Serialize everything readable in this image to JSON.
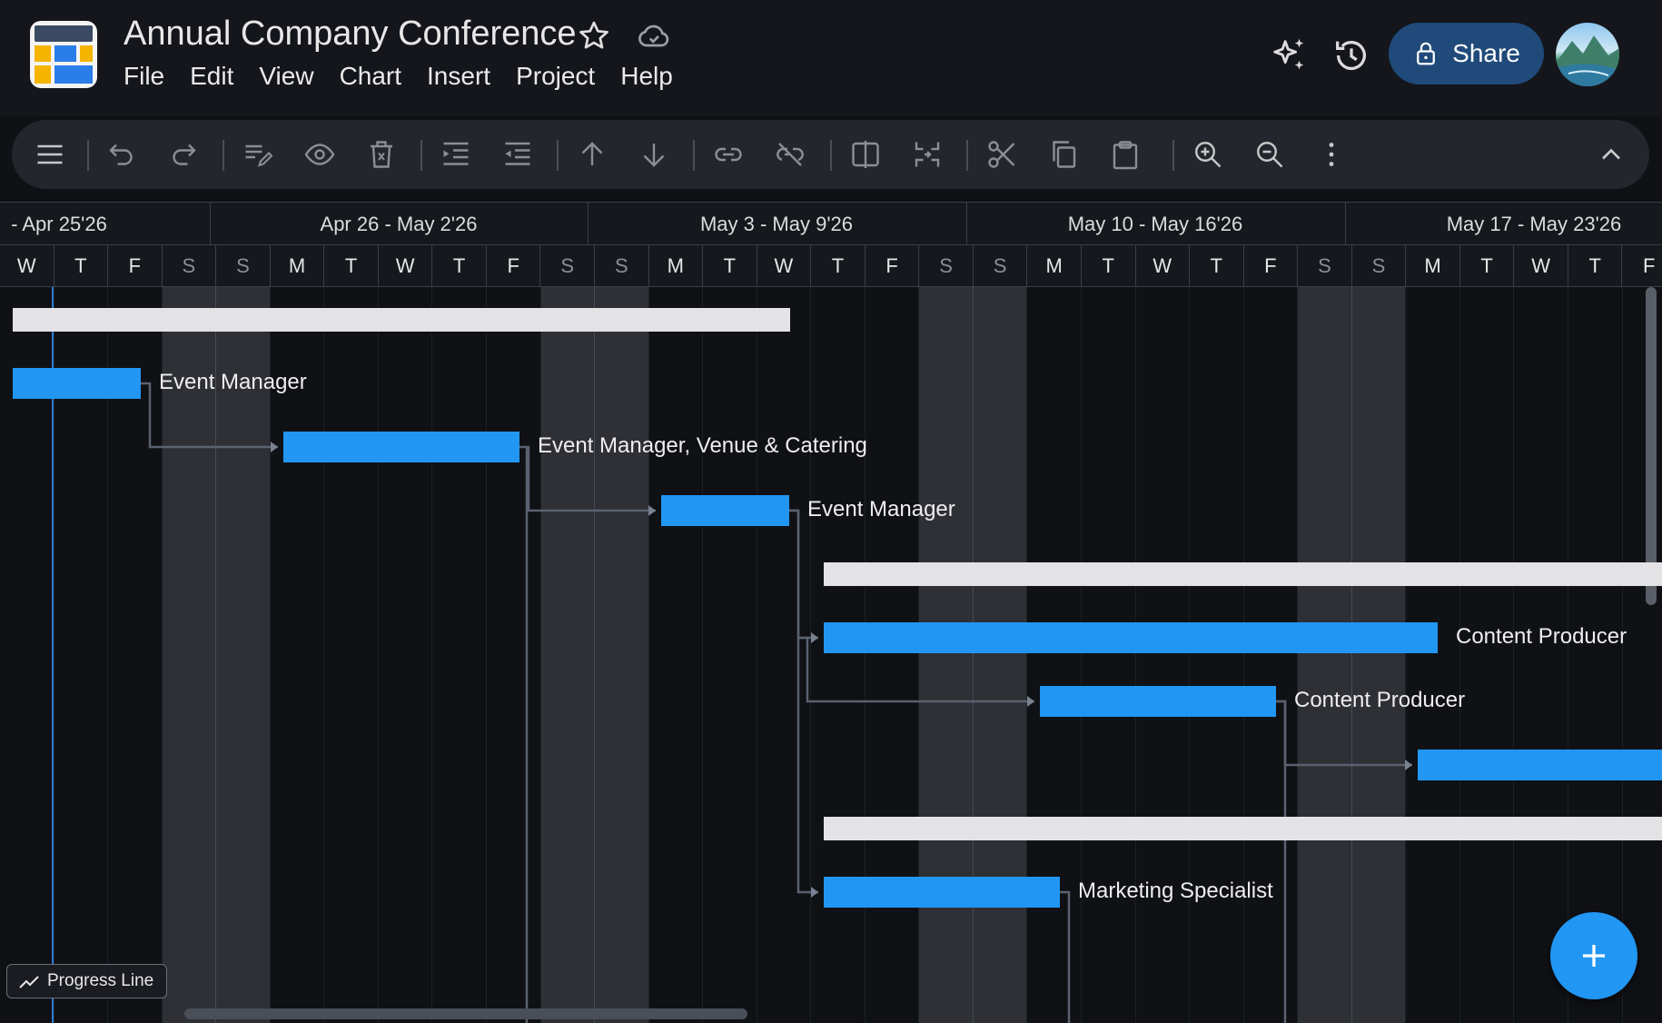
{
  "header": {
    "title": "Annual Company Conference",
    "menu": [
      "File",
      "Edit",
      "View",
      "Chart",
      "Insert",
      "Project",
      "Help"
    ],
    "share_label": "Share"
  },
  "toolbar": {
    "icons": [
      "menu-icon",
      "undo-icon",
      "redo-icon",
      "edit-task-icon",
      "view-icon",
      "delete-icon",
      "indent-icon",
      "outdent-icon",
      "move-up-icon",
      "move-down-icon",
      "link-icon",
      "unlink-icon",
      "split-icon",
      "collapse-icon",
      "cut-icon",
      "copy-icon",
      "paste-icon",
      "zoom-in-icon",
      "zoom-out-icon",
      "more-icon",
      "collapse-toolbar-icon"
    ]
  },
  "timeline": {
    "weeks": [
      "- Apr 25'26",
      "Apr 26 - May 2'26",
      "May 3 - May 9'26",
      "May 10 - May 16'26",
      "May 17 - May 23'26"
    ],
    "days": [
      "W",
      "T",
      "F",
      "S",
      "S",
      "M",
      "T",
      "W",
      "T",
      "F",
      "S",
      "S",
      "M",
      "T",
      "W",
      "T",
      "F",
      "S",
      "S",
      "M",
      "T",
      "W",
      "T",
      "F",
      "S",
      "S",
      "M",
      "T",
      "W",
      "T",
      "F"
    ]
  },
  "tasks": [
    {
      "type": "summary",
      "label": ""
    },
    {
      "type": "task",
      "label": "Event Manager"
    },
    {
      "type": "task",
      "label": "Event Manager, Venue & Catering"
    },
    {
      "type": "task",
      "label": "Event Manager"
    },
    {
      "type": "summary",
      "label": ""
    },
    {
      "type": "task",
      "label": "Content Producer"
    },
    {
      "type": "task",
      "label": "Content Producer"
    },
    {
      "type": "task",
      "label": ""
    },
    {
      "type": "summary",
      "label": ""
    },
    {
      "type": "task",
      "label": "Marketing Specialist"
    }
  ],
  "footer": {
    "progress_line_label": "Progress Line"
  },
  "colors": {
    "bar": "#2196f3",
    "summary": "#e3e3e6",
    "share_button": "#1f4a7a",
    "today_line": "#2d7bd6"
  }
}
